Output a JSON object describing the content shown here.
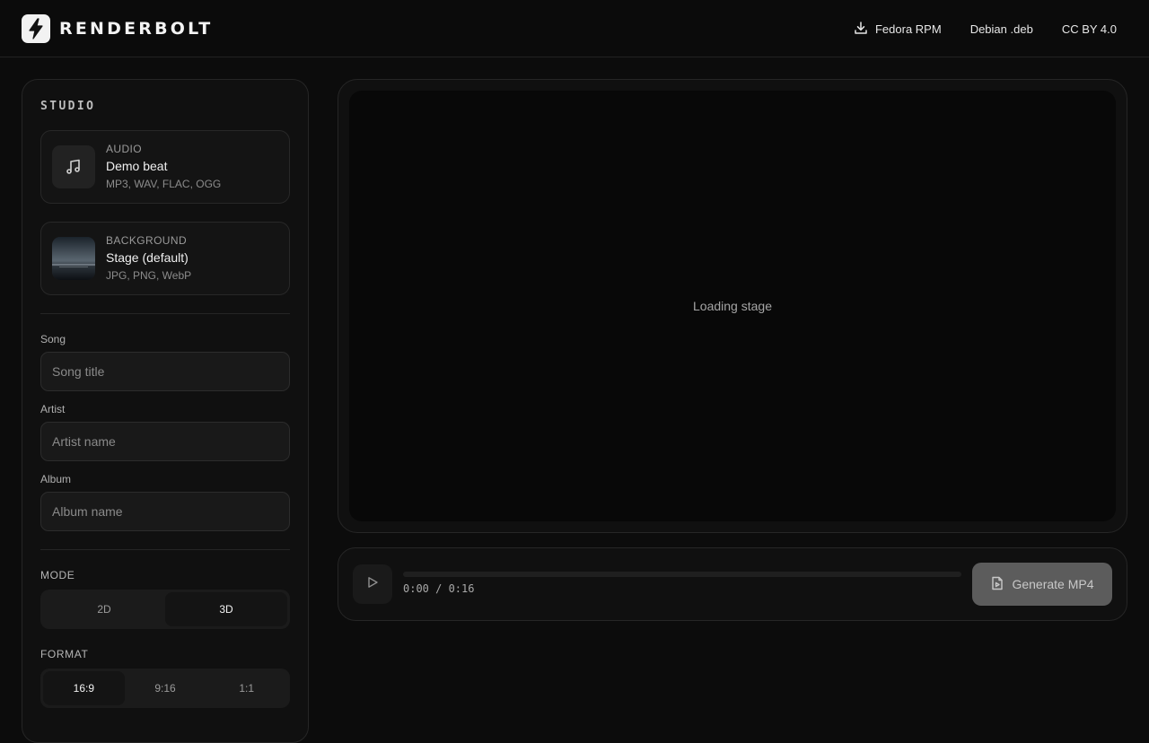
{
  "brand": {
    "name": "RENDERBOLT"
  },
  "nav": {
    "links": [
      {
        "label": "Fedora RPM",
        "icon": "download-icon"
      },
      {
        "label": "Debian .deb"
      },
      {
        "label": "CC BY 4.0"
      }
    ]
  },
  "sidebar": {
    "title": "STUDIO",
    "audio": {
      "kind": "AUDIO",
      "name": "Demo beat",
      "formats": "MP3, WAV, FLAC, OGG",
      "icon": "music-note-icon"
    },
    "background": {
      "kind": "BACKGROUND",
      "name": "Stage (default)",
      "formats": "JPG, PNG, WebP"
    },
    "fields": {
      "song": {
        "label": "Song",
        "placeholder": "Song title",
        "value": ""
      },
      "artist": {
        "label": "Artist",
        "placeholder": "Artist name",
        "value": ""
      },
      "album": {
        "label": "Album",
        "placeholder": "Album name",
        "value": ""
      }
    },
    "mode": {
      "label": "MODE",
      "options": [
        "2D",
        "3D"
      ],
      "selected": "3D"
    },
    "format": {
      "label": "FORMAT",
      "options": [
        "16:9",
        "9:16",
        "1:1"
      ],
      "selected": "16:9"
    }
  },
  "stage": {
    "message": "Loading stage"
  },
  "player": {
    "time": "0:00 / 0:16",
    "progress": 0,
    "generate_label": "Generate MP4"
  },
  "colors": {
    "background": "#0c0c0c",
    "panel": "#101010",
    "border": "#262626",
    "generate_button": "#5c5c5c"
  }
}
